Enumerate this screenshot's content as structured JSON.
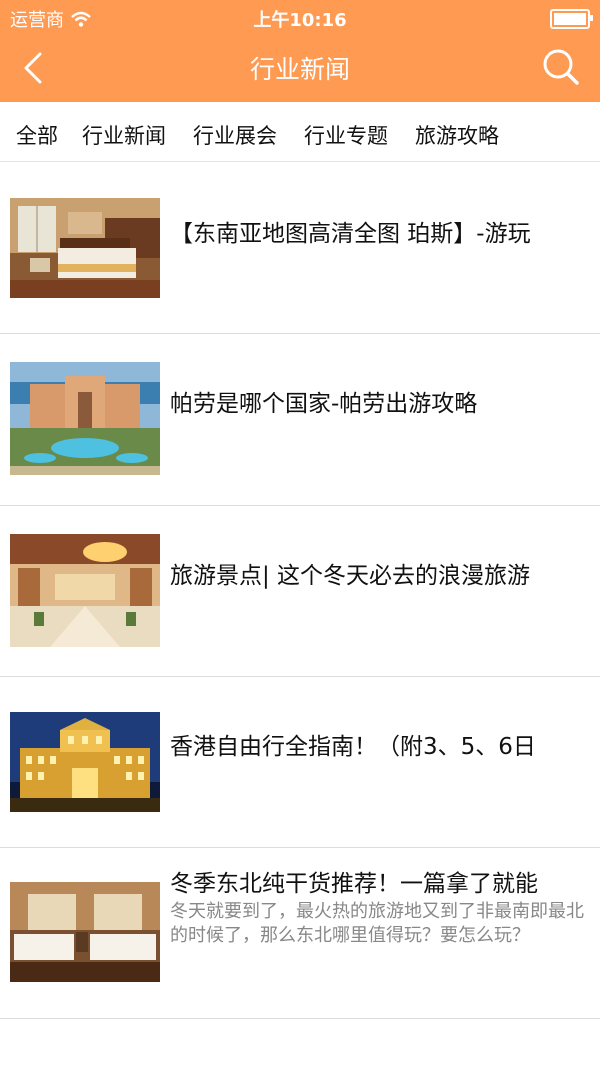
{
  "status_bar": {
    "carrier": "运营商",
    "time": "上午10:16"
  },
  "nav": {
    "title": "行业新闻",
    "back_icon": "chevron-left-icon",
    "search_icon": "search-icon"
  },
  "tabs": [
    "全部",
    "行业新闻",
    "行业展会",
    "行业专题",
    "旅游攻略"
  ],
  "articles": [
    {
      "title": "【东南亚地图高清全图 珀斯】-游玩",
      "image": "hotel-bedroom"
    },
    {
      "title": "帕劳是哪个国家-帕劳出游攻略",
      "image": "resort-pool"
    },
    {
      "title": "旅游景点| 这个冬天必去的浪漫旅游",
      "image": "hotel-lobby"
    },
    {
      "title": "香港自由行全指南！（附3、5、6日",
      "image": "palace-night"
    },
    {
      "title": "冬季东北纯干货推荐！一篇拿了就能",
      "desc": "冬天就要到了，最火热的旅游地又到了非最南即最北的时候了，那么东北哪里值得玩？要怎么玩？",
      "image": "twin-room"
    }
  ],
  "colors": {
    "header": "#ff9a52",
    "divider": "#dddddd"
  }
}
